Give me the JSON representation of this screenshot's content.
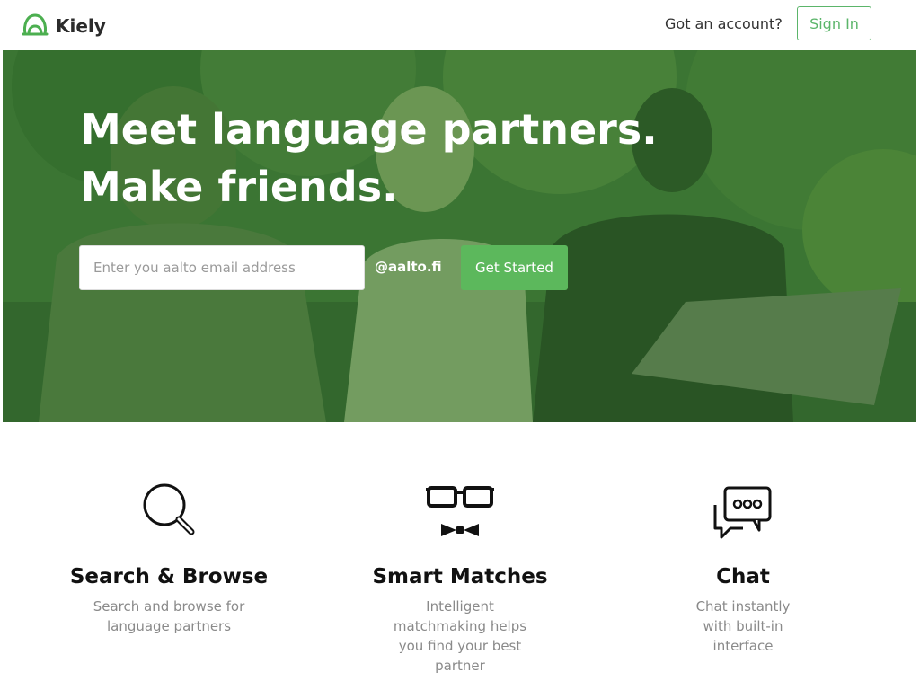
{
  "header": {
    "brand": "Kiely",
    "account_prompt": "Got an account?",
    "signin_label": "Sign In"
  },
  "hero": {
    "title_line1": "Meet language partners.",
    "title_line2": "Make friends.",
    "email_placeholder": "Enter you aalto email address",
    "email_value": "",
    "domain_suffix": "@aalto.fi",
    "cta_label": "Get Started"
  },
  "features": [
    {
      "icon": "magnifier-icon",
      "title": "Search & Browse",
      "description": "Search and browse for language partners"
    },
    {
      "icon": "glasses-bowtie-icon",
      "title": "Smart Matches",
      "description": "Intelligent matchmaking helps you find your best partner"
    },
    {
      "icon": "chat-bubbles-icon",
      "title": "Chat",
      "description": "Chat instantly with built-in interface"
    }
  ],
  "colors": {
    "accent": "#5cb85c",
    "signin_border": "#5bb56a",
    "hero_overlay": "#2f7a2f"
  }
}
